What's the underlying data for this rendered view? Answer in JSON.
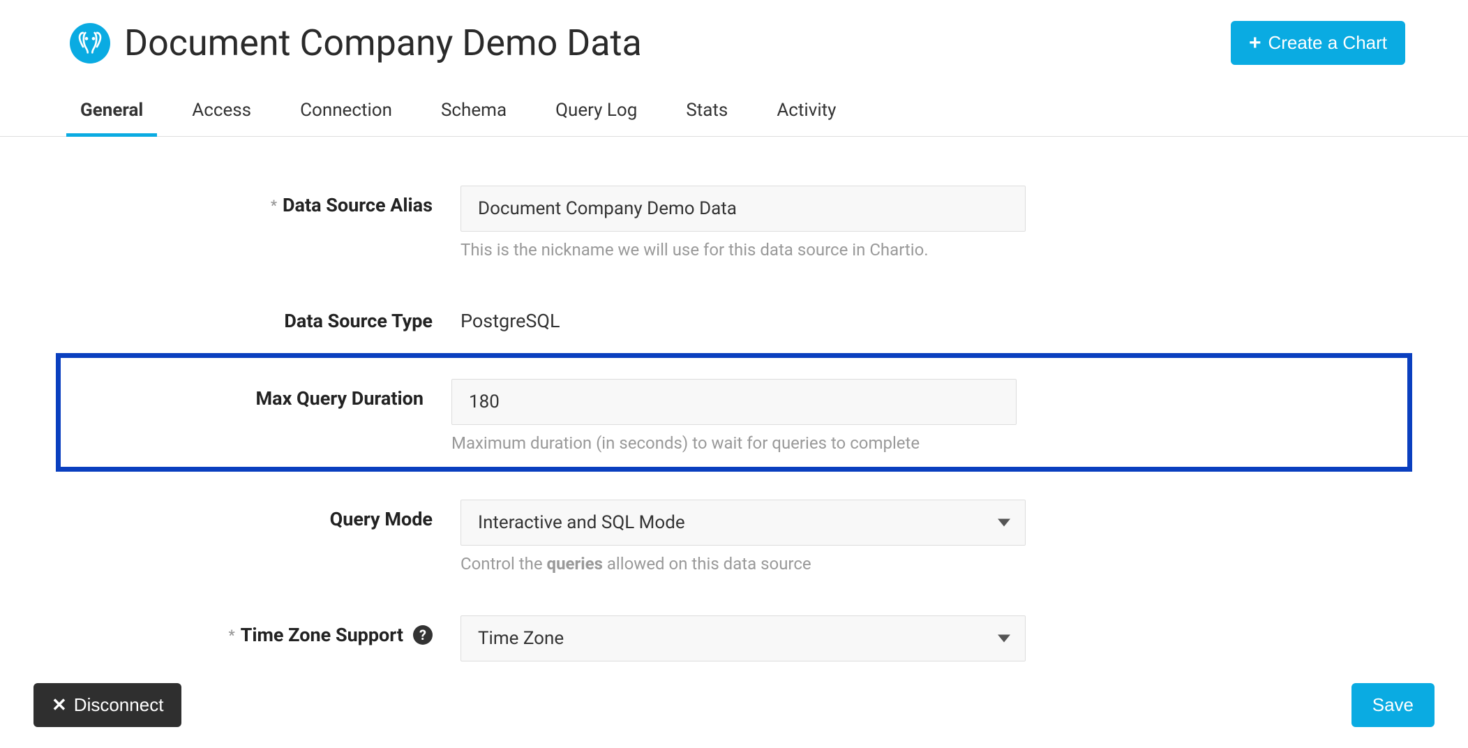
{
  "header": {
    "title": "Document Company Demo Data",
    "create_chart_label": "Create a Chart"
  },
  "tabs": {
    "items": [
      {
        "label": "General",
        "active": true
      },
      {
        "label": "Access",
        "active": false
      },
      {
        "label": "Connection",
        "active": false
      },
      {
        "label": "Schema",
        "active": false
      },
      {
        "label": "Query Log",
        "active": false
      },
      {
        "label": "Stats",
        "active": false
      },
      {
        "label": "Activity",
        "active": false
      }
    ]
  },
  "form": {
    "alias": {
      "label": "Data Source Alias",
      "required_marker": "*",
      "value": "Document Company Demo Data",
      "helper": "This is the nickname we will use for this data source in Chartio."
    },
    "type": {
      "label": "Data Source Type",
      "value": "PostgreSQL"
    },
    "max_query_duration": {
      "label": "Max Query Duration",
      "value": "180",
      "helper": "Maximum duration (in seconds) to wait for queries to complete"
    },
    "query_mode": {
      "label": "Query Mode",
      "value": "Interactive and SQL Mode",
      "helper_pre": "Control the ",
      "helper_bold": "queries",
      "helper_post": " allowed on this data source"
    },
    "time_zone": {
      "label": "Time Zone Support",
      "required_marker": "*",
      "value": "Time Zone"
    }
  },
  "footer": {
    "disconnect_label": "Disconnect",
    "save_label": "Save"
  }
}
